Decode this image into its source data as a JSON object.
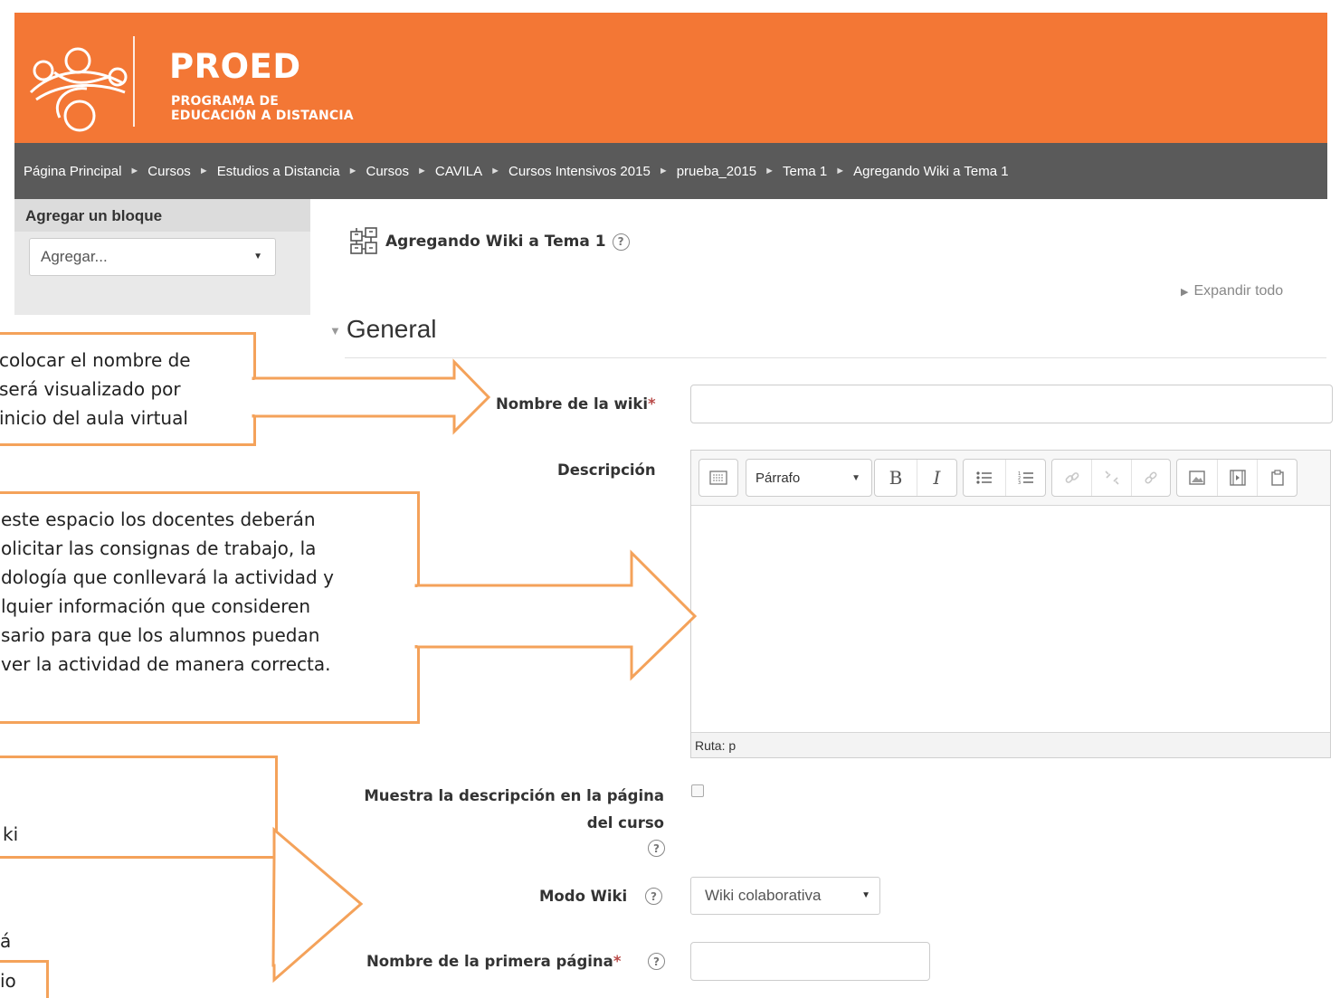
{
  "header": {
    "brand_name": "PROED",
    "brand_sub_line1": "PROGRAMA DE",
    "brand_sub_line2": "EDUCACIÓN A DISTANCIA",
    "brand_color": "#f37735"
  },
  "breadcrumb": {
    "items": [
      "Página Principal",
      "Cursos",
      "Estudios a Distancia",
      "Cursos",
      "CAVILA",
      "Cursos Intensivos 2015",
      "prueba_2015",
      "Tema 1",
      "Agregando Wiki a Tema 1"
    ],
    "separator": "►"
  },
  "block": {
    "title": "Agregar un bloque",
    "select_value": "Agregar..."
  },
  "page": {
    "title": "Agregando Wiki a Tema 1",
    "expand_all": "Expandir todo",
    "section_title": "General"
  },
  "form": {
    "wiki_name_label": "Nombre de la wiki",
    "required_mark": "*",
    "description_label": "Descripción",
    "editor": {
      "paragraph_select": "Párrafo",
      "path_text": "Ruta: p"
    },
    "show_description_label_line1": "Muestra la descripción en la página",
    "show_description_label_line2": "del curso",
    "wiki_mode_label": "Modo Wiki",
    "wiki_mode_value": "Wiki colaborativa",
    "first_page_label": "Nombre de la primera página"
  },
  "annotations": {
    "note1": [
      "colocar el nombre de",
      "será visualizado por",
      "inicio del aula virtual"
    ],
    "note2": [
      "este espacio los docentes deberán",
      "olicitar las consignas de trabajo, la",
      "dología que conllevará la actividad y",
      "lquier información que consideren",
      "sario para que los alumnos puedan",
      "ver la actividad de manera correcta."
    ],
    "note3": [
      "ki"
    ],
    "note4": [
      "á",
      "io"
    ],
    "annotation_color": "#f4a25a"
  },
  "icons": [
    "proed-logo-icon",
    "wiki-icon",
    "help-icon",
    "expand-triangle-icon",
    "collapse-triangle-icon",
    "chevron-down-icon",
    "checkbox-icon"
  ]
}
